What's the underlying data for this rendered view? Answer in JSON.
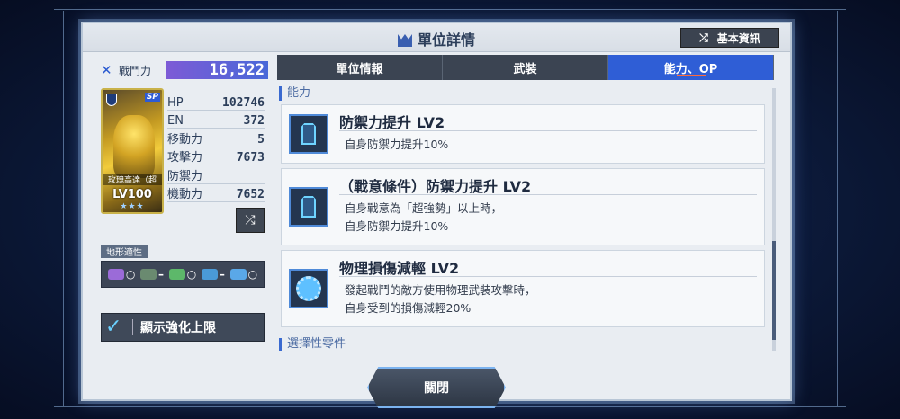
{
  "header": {
    "title": "單位詳情",
    "basic_info_label": "基本資訊"
  },
  "unit": {
    "power_label": "戰鬥力",
    "power_value": "16,522",
    "name": "玫瑰高達（超",
    "level": "LV100",
    "stars": "★★★",
    "badge": "SP",
    "stats": [
      {
        "label": "HP",
        "value": "102746"
      },
      {
        "label": "EN",
        "value": "372"
      },
      {
        "label": "移動力",
        "value": "5"
      },
      {
        "label": "攻擊力",
        "value": "7673"
      },
      {
        "label": "防禦力",
        "value": ""
      },
      {
        "label": "機動力",
        "value": "7652"
      }
    ]
  },
  "terrain": {
    "label": "地形適性",
    "items": [
      {
        "type": "space",
        "grade": "○",
        "color": "#9b6bd8"
      },
      {
        "type": "land",
        "grade": "–",
        "color": "#6a8a70"
      },
      {
        "type": "mountain",
        "grade": "○",
        "color": "#5db86a"
      },
      {
        "type": "water",
        "grade": "–",
        "color": "#4a9ad8"
      },
      {
        "type": "air",
        "grade": "○",
        "color": "#5aa8e8"
      }
    ]
  },
  "enhance_toggle": {
    "label": "顯示強化上限",
    "checked": true
  },
  "tabs": [
    {
      "label": "單位情報",
      "active": false
    },
    {
      "label": "武裝",
      "active": false
    },
    {
      "label": "能力、OP",
      "active": true
    }
  ],
  "abilities_section": "能力",
  "abilities": [
    {
      "name": "防禦力提升 LV2",
      "desc1": "自身防禦力提升10%",
      "desc2": "",
      "icon": "shield-icon"
    },
    {
      "name": "（戰意條件）防禦力提升 LV2",
      "desc1": "自身戰意為「超強勢」以上時，",
      "desc2": "自身防禦力提升10%",
      "icon": "shield-icon"
    },
    {
      "name": "物理損傷減輕 LV2",
      "desc1": "發起戰鬥的敵方使用物理武裝攻擊時，",
      "desc2": "自身受到的損傷減輕20%",
      "icon": "gear-shield-icon"
    }
  ],
  "next_section": "選擇性零件",
  "close_label": "關閉",
  "accent": "#2f5ed6"
}
